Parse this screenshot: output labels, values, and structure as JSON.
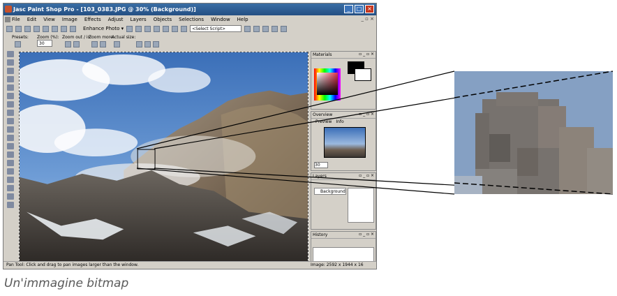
{
  "window": {
    "title": "Jasc Paint Shop Pro - [103_0383.JPG @ 30% (Background)]",
    "title_buttons": [
      "_",
      "□",
      "×"
    ]
  },
  "menubar": [
    "File",
    "Edit",
    "View",
    "Image",
    "Effects",
    "Adjust",
    "Layers",
    "Objects",
    "Selections",
    "Window",
    "Help"
  ],
  "toolbar": {
    "enhance_label": "Enhance Photo ▾",
    "script_select": "<Select Script>"
  },
  "toolbar2": {
    "presets_label": "Presets:",
    "zoom_label": "Zoom (%):",
    "zoom_value": "30",
    "zoom_out_in_label": "Zoom out / in:",
    "zoom_more_label": "Zoom more:",
    "actual_size_label": "Actual size:"
  },
  "palettes": {
    "materials_title": "Materials",
    "overview_title": "Overview",
    "overview_tabs": [
      "Preview",
      "Info"
    ],
    "overview_zoom": "30",
    "layers_title": "Layers",
    "layer_name": "Background",
    "history_title": "History"
  },
  "status": {
    "left": "Pan Tool: Click and drag to pan images larger than the window.",
    "right": "Image: 2592 x 1944 x 16 million"
  },
  "caption": "Un'immagine bitmap",
  "colors": {
    "titlebar": "#2b5a93",
    "chrome": "#d4d0c8",
    "sky": "#4a7fc6",
    "rock": "#8a7a68"
  }
}
